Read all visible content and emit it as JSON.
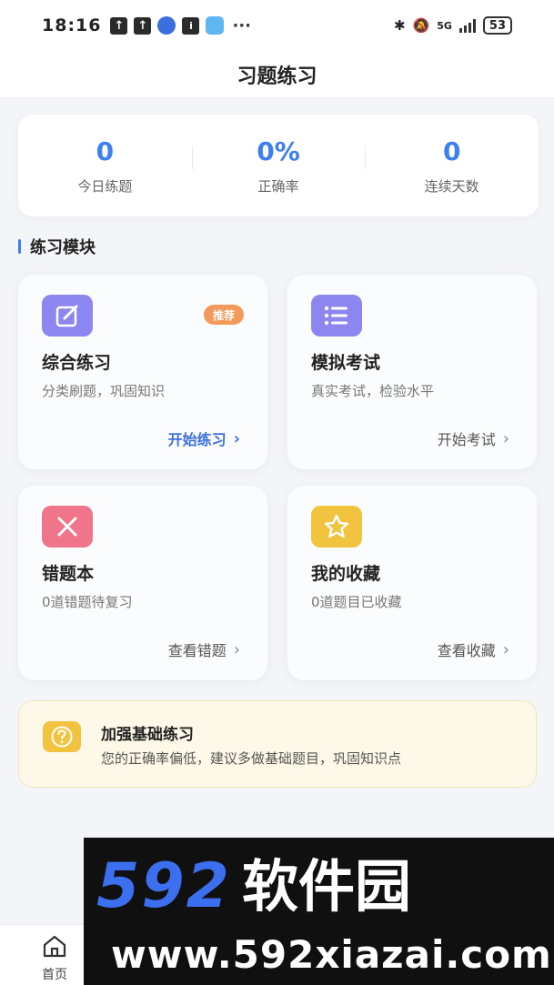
{
  "status_bar": {
    "time": "18:16",
    "notif_icons": [
      "upload-icon",
      "upload-icon",
      "app-icon",
      "app-icon",
      "app-icon"
    ],
    "dots": "···",
    "network": "5G",
    "battery": "53"
  },
  "header": {
    "title": "习题练习"
  },
  "stats": [
    {
      "value": "0",
      "label": "今日练题"
    },
    {
      "value": "0%",
      "label": "正确率"
    },
    {
      "value": "0",
      "label": "连续天数"
    }
  ],
  "section": {
    "title": "练习模块"
  },
  "modules": [
    {
      "name": "综合练习",
      "desc": "分类刷题，巩固知识",
      "action": "开始练习",
      "badge": "推荐",
      "icon": "edit-icon",
      "icon_color": "#8b86f0"
    },
    {
      "name": "模拟考试",
      "desc": "真实考试，检验水平",
      "action": "开始考试",
      "icon": "list-icon",
      "icon_color": "#8b86f0"
    },
    {
      "name": "错题本",
      "desc": "0道错题待复习",
      "action": "查看错题",
      "icon": "close-icon",
      "icon_color": "#f0748a"
    },
    {
      "name": "我的收藏",
      "desc": "0道题目已收藏",
      "action": "查看收藏",
      "icon": "star-icon",
      "icon_color": "#f2c33e"
    }
  ],
  "tip": {
    "title": "加强基础练习",
    "text": "您的正确率偏低，建议多做基础题目，巩固知识点",
    "icon": "question-icon"
  },
  "nav": {
    "home_label": "首页"
  },
  "watermark": {
    "digits": "592",
    "brand": "软件园",
    "url": "www.592xiazai.com"
  },
  "colors": {
    "accent": "#3d7ff2",
    "badge": "#f39a5a",
    "tip_bg": "#fdf8e7"
  }
}
